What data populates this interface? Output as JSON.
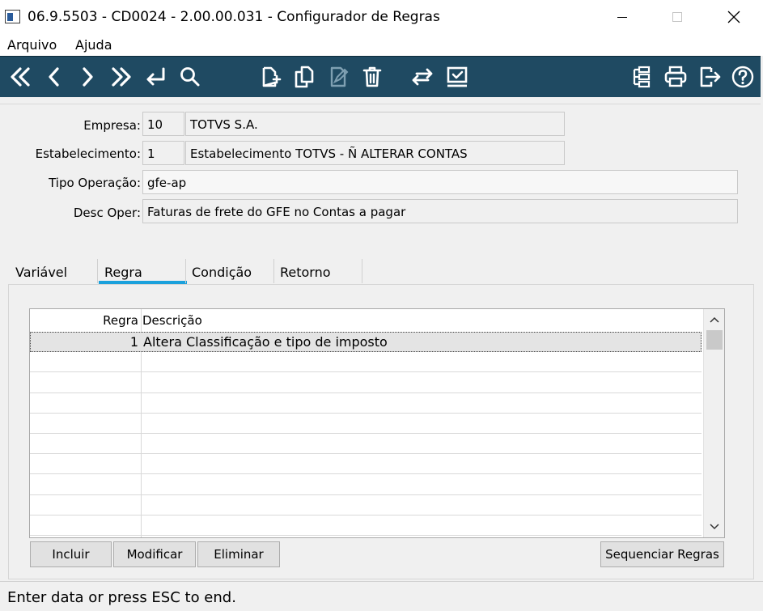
{
  "window": {
    "title": "06.9.5503 - CD0024 - 2.00.00.031 - Configurador de Regras"
  },
  "menu": {
    "items": [
      {
        "label": "Arquivo"
      },
      {
        "label": "Ajuda"
      }
    ]
  },
  "toolbar": {
    "icons": [
      "first-record-icon",
      "previous-record-icon",
      "next-record-icon",
      "last-record-icon",
      "goto-icon",
      "search-icon",
      "new-document-icon",
      "copy-document-icon",
      "edit-document-icon",
      "delete-icon",
      "exchange-icon",
      "confirm-screen-icon",
      "tree-structure-icon",
      "print-icon",
      "exit-icon",
      "help-icon"
    ]
  },
  "header": {
    "empresa": {
      "label": "Empresa:",
      "code": "10",
      "name": "TOTVS S.A."
    },
    "estabelecimento": {
      "label": "Estabelecimento:",
      "code": "1",
      "name": "Estabelecimento TOTVS - Ñ ALTERAR CONTAS"
    },
    "tipo_operacao": {
      "label": "Tipo Operação:",
      "value": "gfe-ap"
    },
    "desc_oper": {
      "label": "Desc Oper:",
      "value": "Faturas de frete do GFE no Contas a pagar"
    }
  },
  "tabs": [
    {
      "label": "Variável"
    },
    {
      "label": "Regra"
    },
    {
      "label": "Condição"
    },
    {
      "label": "Retorno"
    }
  ],
  "grid": {
    "columns": [
      "Regra",
      "Descrição"
    ],
    "rows": [
      {
        "regra": "1",
        "descricao": "Altera Classificação e tipo de imposto"
      }
    ]
  },
  "buttons": {
    "incluir": "Incluir",
    "modificar": "Modificar",
    "eliminar": "Eliminar",
    "sequenciar": "Sequenciar Regras"
  },
  "status": {
    "text": "Enter data or press ESC to end."
  },
  "colors": {
    "toolbar_bg": "#1f4a62",
    "tab_accent": "#1ba1dc"
  }
}
